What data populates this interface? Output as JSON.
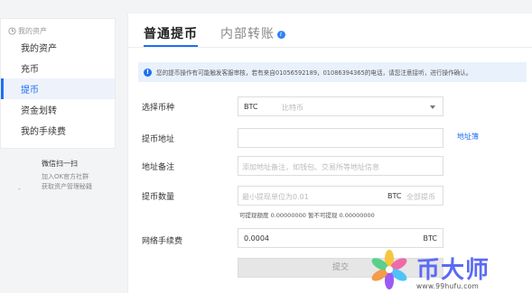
{
  "sidebar": {
    "header": "我的资产",
    "items": [
      {
        "label": "我的资产",
        "active": false
      },
      {
        "label": "充币",
        "active": false
      },
      {
        "label": "提币",
        "active": true
      },
      {
        "label": "资金划转",
        "active": false
      },
      {
        "label": "我的手续费",
        "active": false
      }
    ]
  },
  "qr": {
    "title": "微信扫一扫",
    "dash": "-",
    "line1": "加入OK官方社群",
    "line2": "获取资产管理秘籍"
  },
  "tabs": [
    {
      "label": "普通提币",
      "active": true
    },
    {
      "label": "内部转账",
      "active": false,
      "info": "i"
    }
  ],
  "notice": {
    "icon": "!",
    "text": "您的提币操作有可能触发客服审核，若有来自01056592189，01086394365的电话，请您注意接听，进行操作确认。"
  },
  "form": {
    "currency": {
      "label": "选择币种",
      "value": "BTC",
      "subtext": "比特币"
    },
    "address": {
      "label": "提币地址",
      "value": "",
      "link": "地址簿"
    },
    "note": {
      "label": "地址备注",
      "placeholder": "添加地址备注，如钱包、交易所等地址信息"
    },
    "amount": {
      "label": "提币数量",
      "placeholder": "最小提现单位为0.01",
      "currency": "BTC",
      "all": "全部提币"
    },
    "available": {
      "label1": "可提现额度",
      "value1": "0.00000000",
      "label2": "暂不可提现",
      "value2": "0.00000000"
    },
    "fee": {
      "label": "网络手续费",
      "value": "0.0004",
      "currency": "BTC"
    },
    "submit": "提交"
  },
  "watermark": {
    "title": "币大师",
    "url": "www.99hufu.com",
    "colors": [
      "#f7c53f",
      "#f06aa8",
      "#4fc3f7",
      "#9b59f5",
      "#f39c4a",
      "#5ad08a"
    ]
  },
  "colors": {
    "accent": "#1e6ff1",
    "notice_bg": "#e9f1fd"
  }
}
